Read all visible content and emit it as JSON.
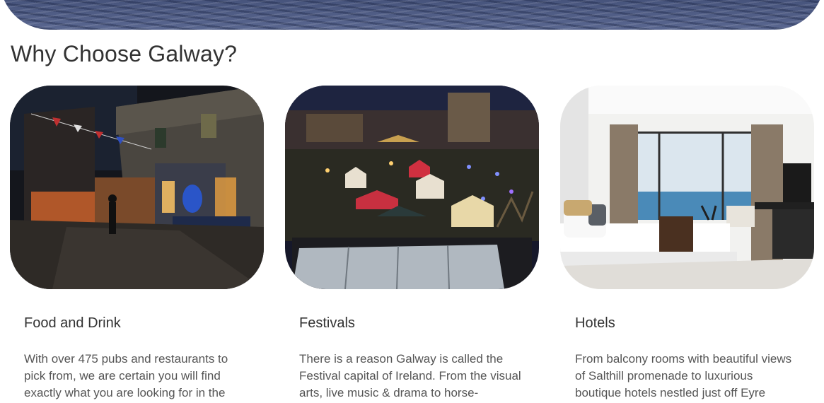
{
  "section": {
    "title": "Why Choose Galway?"
  },
  "cards": [
    {
      "title": "Food and Drink",
      "text": "With over 475 pubs and restaurants to pick from, we are certain you will find exactly what you are looking for in the"
    },
    {
      "title": "Festivals",
      "text": "There is a reason Galway is called the Festival capital of Ireland. From the visual arts, live music & drama to horse-"
    },
    {
      "title": "Hotels",
      "text": "From balcony rooms with beautiful views of Salthill promenade to luxurious boutique hotels nestled just off Eyre"
    }
  ]
}
